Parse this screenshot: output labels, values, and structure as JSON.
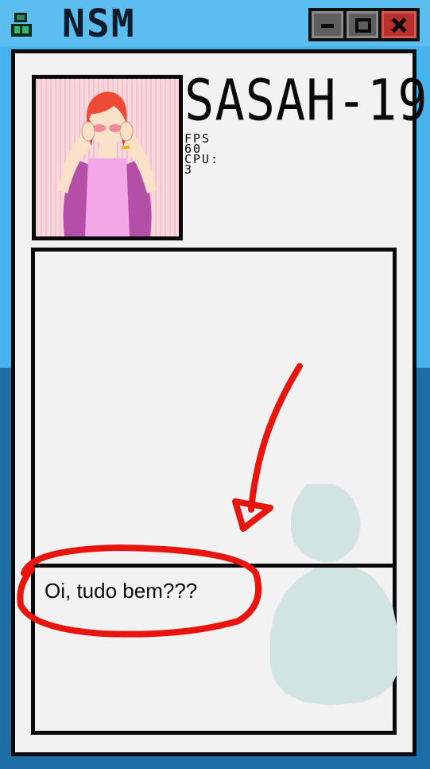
{
  "window": {
    "title": "NSM"
  },
  "profile": {
    "username": "SASAH-19"
  },
  "stats": {
    "fps_label": "FPS",
    "fps_value": "60",
    "cpu_label": "CPU:",
    "cpu_value": "3"
  },
  "chat": {
    "message": "Oi, tudo bem???"
  },
  "colors": {
    "sky": "#47b3ec",
    "deep": "#1d6ea6",
    "annotation": "#e8140e"
  },
  "icons": {
    "app": "pixel-figure-icon",
    "minimize": "minimize-icon",
    "maximize": "maximize-icon",
    "close": "close-icon"
  }
}
